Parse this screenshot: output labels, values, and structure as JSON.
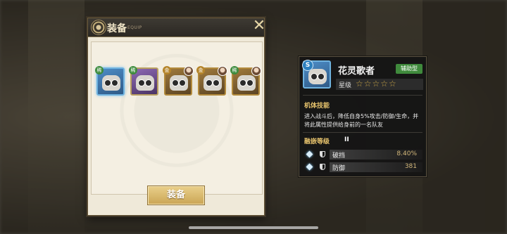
{
  "equip_panel": {
    "title": "装备",
    "subtitle": "EQUIP",
    "close_glyph": "✕",
    "equip_button": "装备",
    "slots": [
      {
        "badge": "稀",
        "selected": true
      },
      {
        "badge": "稀"
      },
      {
        "badge": "金"
      },
      {
        "badge": "金"
      },
      {
        "badge": "稀"
      }
    ]
  },
  "info_card": {
    "rank": "S",
    "name": "花灵歌者",
    "role": "辅助型",
    "star_label": "星级",
    "stars": "☆☆☆☆☆",
    "skill_title": "机体技能",
    "skill_desc": "进入战斗后，降低自身5%攻击/防御/生命，并将此属性提供给身前的一名队友",
    "fusion_title": "融嵌等级",
    "fusion_level": "II",
    "stats": [
      {
        "name": "破挡",
        "value": "8.40%"
      },
      {
        "name": "防御",
        "value": "381"
      }
    ]
  },
  "colors": {
    "accent_gold": "#e8c46d",
    "role_green": "#3f8a3c",
    "selected_blue": "#6fb3e0"
  }
}
